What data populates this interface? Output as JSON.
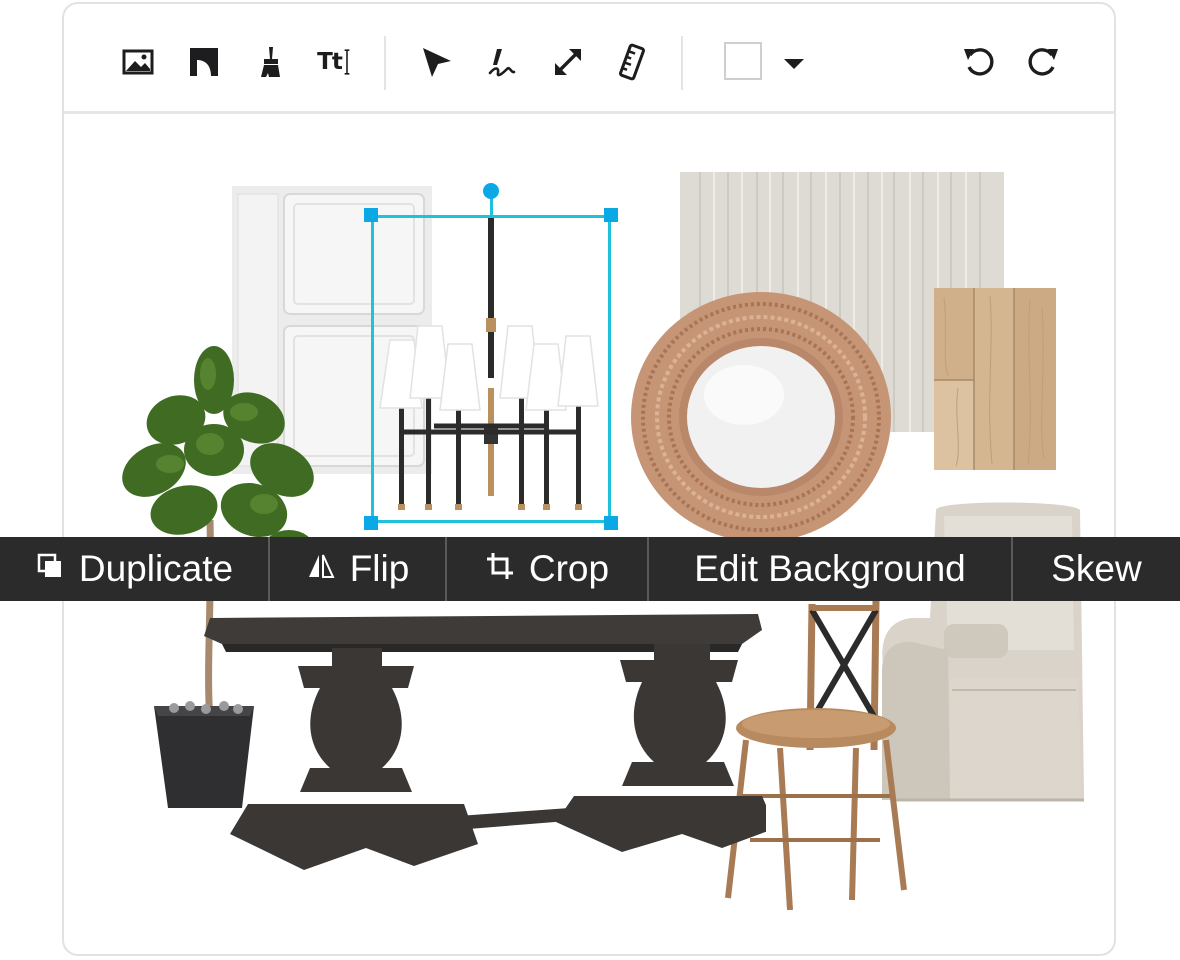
{
  "toolbar": {
    "tools": [
      {
        "name": "image-icon",
        "label": "Add image"
      },
      {
        "name": "shape-icon",
        "label": "Shape"
      },
      {
        "name": "brush-icon",
        "label": "Brush"
      },
      {
        "name": "text-icon",
        "label": "Tt"
      },
      {
        "name": "pointer-icon",
        "label": "Select"
      },
      {
        "name": "draw-icon",
        "label": "Draw"
      },
      {
        "name": "resize-icon",
        "label": "Resize"
      },
      {
        "name": "ruler-icon",
        "label": "Measure"
      },
      {
        "name": "undo-icon",
        "label": "Undo"
      },
      {
        "name": "redo-icon",
        "label": "Redo"
      }
    ],
    "text_tool_glyph": "Tt",
    "fill_color": "#ffffff",
    "accent_color": "#1fc2dc"
  },
  "context_menu": {
    "items": [
      {
        "label": "Duplicate",
        "icon": "duplicate-icon"
      },
      {
        "label": "Flip",
        "icon": "flip-icon"
      },
      {
        "label": "Crop",
        "icon": "crop-icon"
      },
      {
        "label": "Edit Background",
        "icon": ""
      },
      {
        "label": "Skew",
        "icon": ""
      }
    ]
  },
  "canvas": {
    "items": [
      "wall-panel",
      "chandelier",
      "rug-sample",
      "wood-floor-sample",
      "round-mirror",
      "fiddle-leaf-plant",
      "dining-table",
      "cross-back-chair",
      "wingback-armchair"
    ],
    "selected_item": "chandelier"
  }
}
